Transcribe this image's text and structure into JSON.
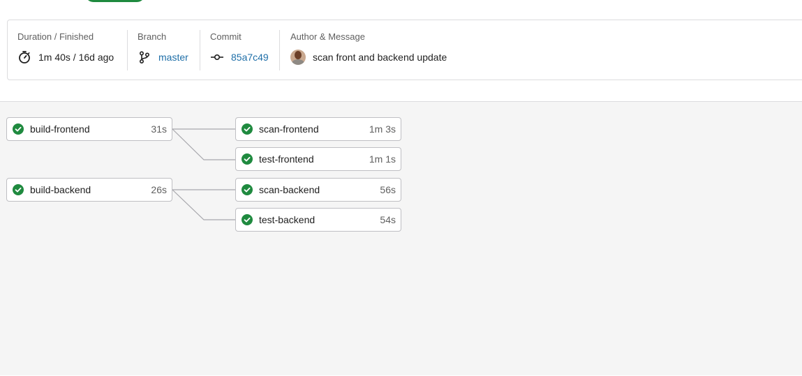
{
  "pipeline_info": {
    "duration": {
      "label": "Duration / Finished",
      "value": "1m 40s / 16d ago",
      "icon": "timer-icon"
    },
    "branch": {
      "label": "Branch",
      "value": "master",
      "icon": "branch-icon"
    },
    "commit": {
      "label": "Commit",
      "value": "85a7c49",
      "icon": "commit-icon"
    },
    "author": {
      "label": "Author & Message",
      "message": "scan front and backend update",
      "icon": "avatar"
    }
  },
  "colors": {
    "success": "#1f8a3f",
    "link": "#1f6fa8"
  },
  "graph": {
    "stage1": [
      {
        "name": "build-frontend",
        "duration": "31s",
        "status": "success"
      },
      {
        "name": "build-backend",
        "duration": "26s",
        "status": "success"
      }
    ],
    "stage2": [
      {
        "name": "scan-frontend",
        "duration": "1m 3s",
        "status": "success"
      },
      {
        "name": "test-frontend",
        "duration": "1m 1s",
        "status": "success"
      },
      {
        "name": "scan-backend",
        "duration": "56s",
        "status": "success"
      },
      {
        "name": "test-backend",
        "duration": "54s",
        "status": "success"
      }
    ]
  }
}
